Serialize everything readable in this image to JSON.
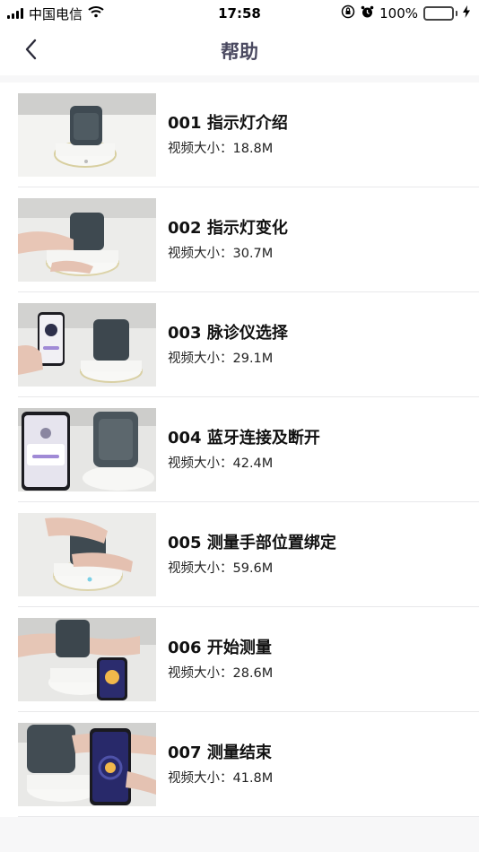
{
  "status_bar": {
    "carrier": "中国电信",
    "time": "17:58",
    "battery_percent": "100%",
    "battery_level": 1.0
  },
  "nav": {
    "title": "帮助",
    "back_icon": "chevron-left-icon"
  },
  "videos": [
    {
      "title": "001 指示灯介绍",
      "size_label": "视频大小：",
      "size": "18.8M"
    },
    {
      "title": "002 指示灯变化",
      "size_label": "视频大小：",
      "size": "30.7M"
    },
    {
      "title": "003 脉诊仪选择",
      "size_label": "视频大小：",
      "size": "29.1M"
    },
    {
      "title": "004 蓝牙连接及断开",
      "size_label": "视频大小：",
      "size": "42.4M"
    },
    {
      "title": "005 测量手部位置绑定",
      "size_label": "视频大小：",
      "size": "59.6M"
    },
    {
      "title": "006 开始测量",
      "size_label": "视频大小：",
      "size": "28.6M"
    },
    {
      "title": "007 测量结束",
      "size_label": "视频大小：",
      "size": "41.8M"
    }
  ]
}
